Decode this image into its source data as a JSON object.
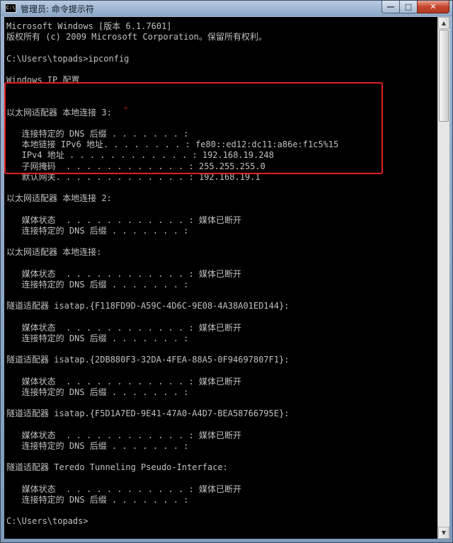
{
  "window": {
    "title": "管理员: 命令提示符",
    "icon_text": "C:\\",
    "controls": {
      "minimize": "—",
      "maximize": "□",
      "close": "✕"
    }
  },
  "console": {
    "lines": [
      "Microsoft Windows [版本 6.1.7601]",
      "版权所有 (c) 2009 Microsoft Corporation。保留所有权利。",
      "",
      "C:\\Users\\topads>ipconfig",
      "",
      "Windows IP 配置",
      "",
      "",
      "以太网适配器 本地连接 3:",
      "",
      "   连接特定的 DNS 后缀 . . . . . . . :",
      "   本地链接 IPv6 地址. . . . . . . . : fe80::ed12:dc11:a86e:f1c5%15",
      "   IPv4 地址 . . . . . . . . . . . . : 192.168.19.248",
      "   子网掩码  . . . . . . . . . . . . : 255.255.255.0",
      "   默认网关. . . . . . . . . . . . . : 192.168.19.1",
      "",
      "以太网适配器 本地连接 2:",
      "",
      "   媒体状态  . . . . . . . . . . . . : 媒体已断开",
      "   连接特定的 DNS 后缀 . . . . . . . :",
      "",
      "以太网适配器 本地连接:",
      "",
      "   媒体状态  . . . . . . . . . . . . : 媒体已断开",
      "   连接特定的 DNS 后缀 . . . . . . . :",
      "",
      "隧道适配器 isatap.{F118FD9D-A59C-4D6C-9E08-4A38A01ED144}:",
      "",
      "   媒体状态  . . . . . . . . . . . . : 媒体已断开",
      "   连接特定的 DNS 后缀 . . . . . . . :",
      "",
      "隧道适配器 isatap.{2DB880F3-32DA-4FEA-88A5-0F94697807F1}:",
      "",
      "   媒体状态  . . . . . . . . . . . . : 媒体已断开",
      "   连接特定的 DNS 后缀 . . . . . . . :",
      "",
      "隧道适配器 isatap.{F5D1A7ED-9E41-47A0-A4D7-BEA58766795E}:",
      "",
      "   媒体状态  . . . . . . . . . . . . : 媒体已断开",
      "   连接特定的 DNS 后缀 . . . . . . . :",
      "",
      "隧道适配器 Teredo Tunneling Pseudo-Interface:",
      "",
      "   媒体状态  . . . . . . . . . . . . : 媒体已断开",
      "   连接特定的 DNS 后缀 . . . . . . . :",
      "",
      "C:\\Users\\topads>"
    ]
  },
  "annotation": {
    "color": "#e02020",
    "marker": "⌄"
  },
  "colors": {
    "console_bg": "#000000",
    "console_fg": "#c0c0c0"
  }
}
